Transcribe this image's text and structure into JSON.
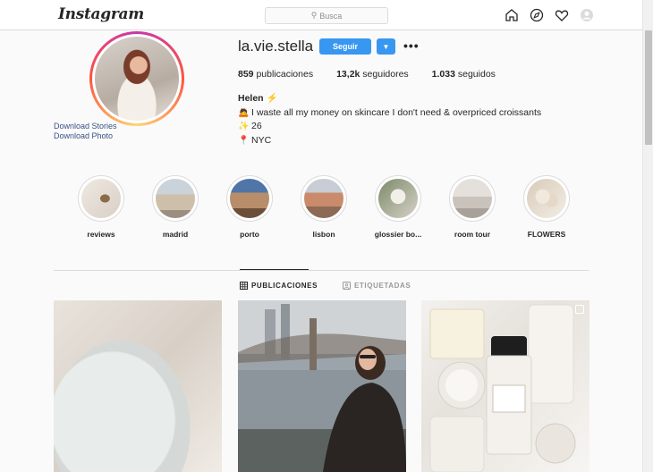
{
  "topnav": {
    "logo": "Instagram",
    "search_placeholder": "Busca",
    "icons": [
      "home-icon",
      "explore-icon",
      "heart-icon",
      "profile-icon"
    ]
  },
  "profile": {
    "username": "la.vie.stella",
    "follow_label": "Seguir",
    "download_stories": "Download Stories",
    "download_photo": "Download Photo",
    "stats": {
      "posts_count": "859",
      "posts_label": "publicaciones",
      "followers_count": "13,2k",
      "followers_label": "seguidores",
      "following_count": "1.033",
      "following_label": "seguidos"
    },
    "bio": {
      "name": "Helen",
      "name_emoji": "⚡",
      "line1_emoji": "🙇",
      "line1": "I waste all my money on skincare I don't need & overpriced croissants",
      "line2_emoji": "✨",
      "line2": "26",
      "line3_emoji": "📍",
      "line3": "NYC"
    }
  },
  "highlights": [
    {
      "label": "reviews"
    },
    {
      "label": "madrid"
    },
    {
      "label": "porto"
    },
    {
      "label": "lisbon"
    },
    {
      "label": "glossier bo..."
    },
    {
      "label": "room tour"
    },
    {
      "label": "FLOWERS"
    }
  ],
  "tabs": {
    "posts": "PUBLICACIONES",
    "tagged": "ETIQUETADAS"
  },
  "colors": {
    "accent": "#3897f0",
    "link": "#385185",
    "border": "#dbdbdb"
  }
}
